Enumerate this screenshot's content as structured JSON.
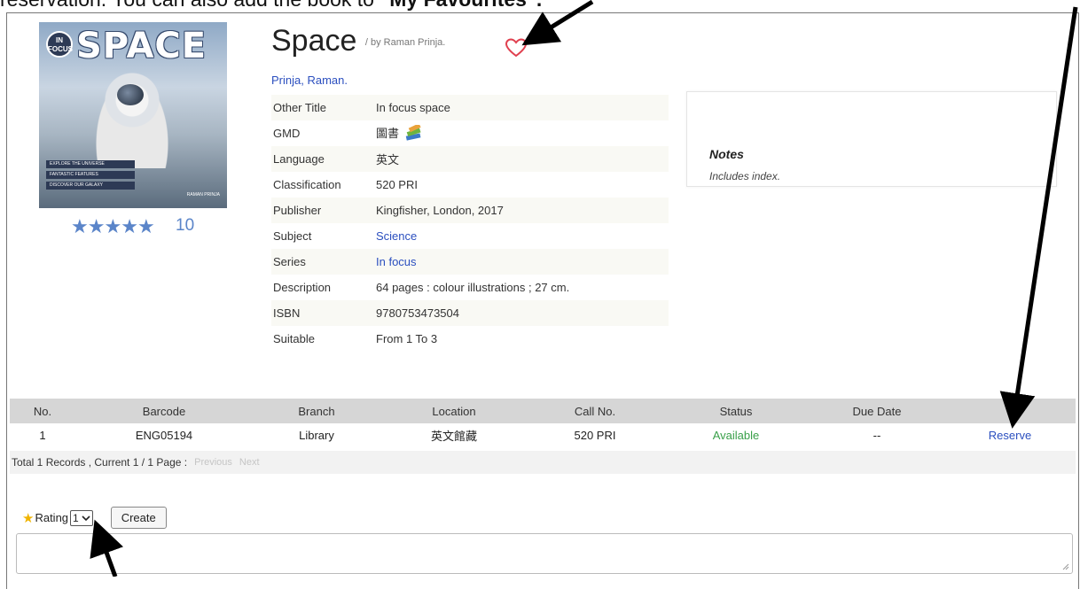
{
  "instruction": {
    "prefix": "reservation. You can also add the book to ",
    "bold": "\"My Favourites\"."
  },
  "cover": {
    "badge": "IN FOCUS",
    "title": "SPACE",
    "strips": [
      "EXPLORE THE UNIVERSE",
      "FANTASTIC FEATURES",
      "DISCOVER OUR GALAXY"
    ],
    "footer": "RAMAN PRINJA"
  },
  "rating": {
    "stars": 5,
    "count": "10",
    "accent": "#5b85c9"
  },
  "book": {
    "title": "Space",
    "byline": "/ by Raman Prinja.",
    "author": "Prinja, Raman."
  },
  "details": [
    {
      "label": "Other Title",
      "value": "In focus space",
      "link": false
    },
    {
      "label": "GMD",
      "value": "圖書",
      "link": false,
      "icon": "books-icon"
    },
    {
      "label": "Language",
      "value": "英文",
      "link": false
    },
    {
      "label": "Classification",
      "value": "520 PRI",
      "link": false
    },
    {
      "label": "Publisher",
      "value": "Kingfisher, London, 2017",
      "link": false
    },
    {
      "label": "Subject",
      "value": "Science",
      "link": true
    },
    {
      "label": "Series",
      "value": "In focus",
      "link": true
    },
    {
      "label": "Description",
      "value": "64 pages : colour illustrations ; 27 cm.",
      "link": false
    },
    {
      "label": "ISBN",
      "value": "9780753473504",
      "link": false
    },
    {
      "label": "Suitable",
      "value": "From 1 To 3",
      "link": false
    }
  ],
  "notes": {
    "heading": "Notes",
    "text": "Includes index."
  },
  "holdings": {
    "columns": [
      "No.",
      "Barcode",
      "Branch",
      "Location",
      "Call No.",
      "Status",
      "Due Date",
      ""
    ],
    "rows": [
      {
        "no": "1",
        "barcode": "ENG05194",
        "branch": "Library",
        "location": "英文館藏",
        "call_no": "520 PRI",
        "status": "Available",
        "due": "--",
        "action": "Reserve"
      }
    ],
    "status_color": "#3aa04a"
  },
  "pager": {
    "summary": "Total 1 Records , Current 1 / 1 Page :",
    "previous": "Previous",
    "next": "Next"
  },
  "rating_form": {
    "label": "Rating",
    "selected": "1",
    "create_label": "Create",
    "comment_value": ""
  }
}
